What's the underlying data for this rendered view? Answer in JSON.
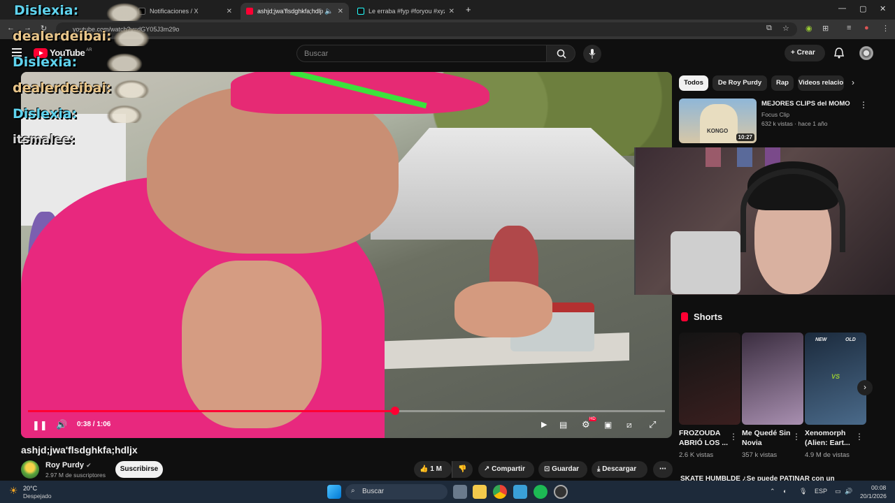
{
  "browser": {
    "tabs": [
      {
        "title": "Notificaciones / X",
        "favicon_color": "#000000"
      },
      {
        "title": "ashjd;jwa'flsdghkfa;hdljx - Y",
        "favicon_color": "#ff0033"
      },
      {
        "title": "Le erraba #fyp #foryou #xyzbca",
        "favicon_color": "#111111"
      }
    ],
    "new_tab": "+",
    "url": "youtube.com/watch?v=dGY05J3m29o",
    "window_controls": {
      "minimize": "—",
      "maximize": "▢",
      "close": "✕"
    }
  },
  "youtube": {
    "logo_text": "YouTube",
    "country_code": "AR",
    "search_placeholder": "Buscar",
    "create_label": "Crear"
  },
  "stream_chat": [
    {
      "user": "Dislexia:",
      "style": "user1"
    },
    {
      "user": "dealerdeibai:",
      "style": "user2"
    },
    {
      "user": "Dislexia:",
      "style": "user1"
    },
    {
      "user": "dealerdeibai:",
      "style": "user2"
    },
    {
      "user": "Dislexia:",
      "style": "user1"
    },
    {
      "user": "itsmalee:",
      "style": "user3"
    }
  ],
  "player": {
    "time": "0:38 / 1:06",
    "progress": 0.576,
    "hd_badge": "HD"
  },
  "video": {
    "title": "ashjd;jwa'flsdghkfa;hdljx",
    "channel": "Roy Purdy",
    "subscribers": "2.97 M de suscriptores",
    "subscribe_label": "Suscribirse",
    "likes": "1 M",
    "share_label": "Compartir",
    "save_label": "Guardar",
    "download_label": "Descargar"
  },
  "sidebar": {
    "chips": [
      "Todos",
      "De Roy Purdy",
      "Rap",
      "Videos relacio"
    ],
    "recommended": {
      "title": "MEJORES CLIPS del MOMO",
      "channel": "Focus Clip",
      "meta": "632 k vistas · hace 1 año",
      "duration": "10:27",
      "thumb_text": "KONGO"
    },
    "shorts_heading": "Shorts",
    "shorts": [
      {
        "title": "FROZOUDA ABRIÓ LOS ...",
        "views": "2.6 K vistas",
        "colors": [
          "#141414",
          "#3a1f1f"
        ]
      },
      {
        "title": "Me Quedé Sin Novia",
        "views": "357 k vistas",
        "colors": [
          "#3a2d3f",
          "#a88fb0"
        ]
      },
      {
        "title": "Xenomorph (Alien: Eart...",
        "views": "4.9 M de vistas",
        "colors": [
          "#1b2a3c",
          "#4a6a8a"
        ]
      }
    ],
    "shorts_badges": {
      "new": "NEW",
      "old": "OLD",
      "vs": "VS"
    },
    "next_card_text": "SKATE HUMBLDE  ¿Se puede PATINAR con un"
  },
  "taskbar": {
    "weather_temp": "20°C",
    "weather_desc": "Despejado",
    "search_label": "Buscar",
    "lang": "ESP",
    "time": "00:08",
    "date": "20/1/2026"
  }
}
